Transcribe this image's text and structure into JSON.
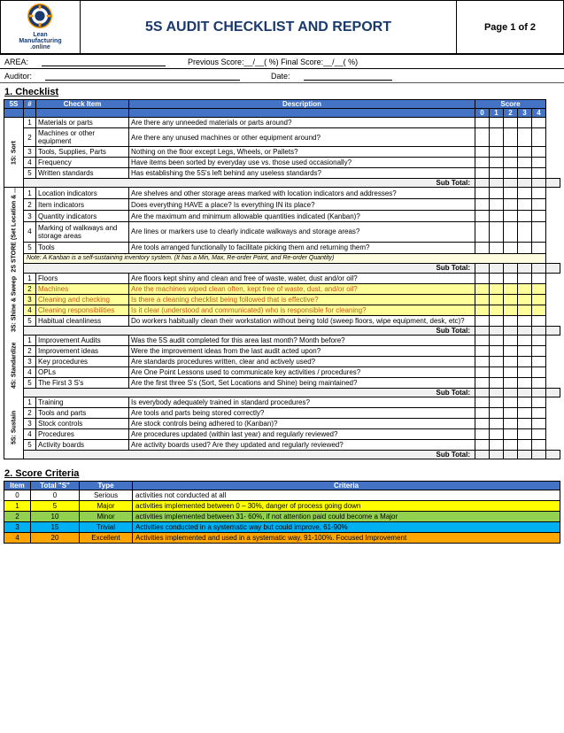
{
  "header": {
    "title": "5S AUDIT CHECKLIST AND REPORT",
    "page": "Page 1 of 2",
    "logo_line1": "Lean",
    "logo_line2": "Manufacturing",
    "logo_line3": ".online"
  },
  "form": {
    "area_label": "AREA:",
    "prev_score_label": "Previous Score:__/__( %) Final Score:__/__( %)",
    "auditor_label": "Auditor:",
    "date_label": "Date:"
  },
  "section1_title": "1. Checklist",
  "table_headers": {
    "five_s": "5S",
    "num": "#",
    "check_item": "Check Item",
    "description": "Description",
    "score": "Score",
    "score_nums": [
      "0",
      "1",
      "2",
      "3",
      "4"
    ]
  },
  "categories": [
    {
      "name": "1S: Sort",
      "items": [
        {
          "num": 1,
          "check": "Materials or parts",
          "desc": "Are there any unneeded materials or parts around?"
        },
        {
          "num": 2,
          "check": "Machines or other equipment",
          "desc": "Are there any unused machines or other equipment around?"
        },
        {
          "num": 3,
          "check": "Tools, Supplies, Parts",
          "desc": "Nothing on the floor except Legs, Wheels, or Pallets?"
        },
        {
          "num": 4,
          "check": "Frequency",
          "desc": "Have items been sorted by everyday use vs. those used occasionally?"
        },
        {
          "num": 5,
          "check": "Written standards",
          "desc": "Has establishing the 5S's left behind any useless standards?"
        }
      ],
      "subtotal": "Sub Total:"
    },
    {
      "name": "2S STORE (Set Location & ...",
      "items": [
        {
          "num": 1,
          "check": "Location indicators",
          "desc": "Are shelves and other storage areas marked with location indicators and addresses?"
        },
        {
          "num": 2,
          "check": "Item indicators",
          "desc": "Does everything HAVE a place?  Is everything IN its place?"
        },
        {
          "num": 3,
          "check": "Quantity indicators",
          "desc": "Are the maximum and minimum allowable quantities indicated (Kanban)?"
        },
        {
          "num": 4,
          "check": "Marking of walkways and storage areas",
          "desc": "Are lines or markers use to clearly indicate walkways and storage areas?"
        },
        {
          "num": 5,
          "check": "Tools",
          "desc": "Are tools arranged functionally to facilitate picking them and returning them?"
        }
      ],
      "note": "Note: A Kanban is a self-sustaining inventory system. (It has a Min, Max, Re-order Point, and Re-order Quantity)",
      "subtotal": "Sub Total:"
    },
    {
      "name": "3S: Shine & Sweep",
      "items": [
        {
          "num": 1,
          "check": "Floors",
          "desc": "Are floors kept shiny and clean and free of waste, water, dust and/or oil?"
        },
        {
          "num": 2,
          "check": "Machines",
          "desc": "Are the machines wiped clean often, kept free of waste, dust, and/or oil?",
          "highlight": true
        },
        {
          "num": 3,
          "check": "Cleaning and checking",
          "desc": "Is there a cleaning checklist being followed that is effective?",
          "highlight": true
        },
        {
          "num": 4,
          "check": "Cleaning responsibilities",
          "desc": "Is it clear (understood and communicated) who is responsible for cleaning?",
          "highlight": true
        },
        {
          "num": 5,
          "check": "Habitual cleanliness",
          "desc": "Do workers habitually clean their workstation without being told (sweep floors, wipe equipment, desk, etc)?"
        }
      ],
      "subtotal": "Sub Total:"
    },
    {
      "name": "4S: Standardize",
      "items": [
        {
          "num": 1,
          "check": "Improvement Audits",
          "desc": "Was the 5S audit completed for this area last month? Month before?"
        },
        {
          "num": 2,
          "check": "Improvement ideas",
          "desc": "Were the improvement ideas from the last audit acted upon?"
        },
        {
          "num": 3,
          "check": "Key procedures",
          "desc": "Are standards procedures written, clear and actively used?"
        },
        {
          "num": 4,
          "check": "OPLs",
          "desc": "Are One Point Lessons used to communicate key activities / procedures?"
        },
        {
          "num": 5,
          "check": "The First 3 S's",
          "desc": "Are the first three S's (Sort, Set Locations and Shine) being maintained?"
        }
      ],
      "subtotal": "Sub Total:"
    },
    {
      "name": "5S: Sustain",
      "items": [
        {
          "num": 1,
          "check": "Training",
          "desc": "Is everybody adequately trained in standard procedures?"
        },
        {
          "num": 2,
          "check": "Tools and parts",
          "desc": "Are tools and parts being stored correctly?"
        },
        {
          "num": 3,
          "check": "Stock controls",
          "desc": "Are stock controls being adhered to (Kanban)?"
        },
        {
          "num": 4,
          "check": "Procedures",
          "desc": "Are procedures updated (within last year) and regularly reviewed?"
        },
        {
          "num": 5,
          "check": "Activity boards",
          "desc": "Are activity boards used?  Are they updated and regularly reviewed?"
        }
      ],
      "subtotal": "Sub Total:"
    }
  ],
  "section2_title": "2. Score Criteria",
  "criteria_headers": [
    "Item",
    "Total \"S\"",
    "Type",
    "Criteria"
  ],
  "criteria_rows": [
    {
      "item": 0,
      "total": 0,
      "type": "Serious",
      "criteria": "activities not conducted at all",
      "color": "white"
    },
    {
      "item": 1,
      "total": 5,
      "type": "Major",
      "criteria": "activities implemented between 0 – 30%, danger of process going down",
      "color": "yellow"
    },
    {
      "item": 2,
      "total": 10,
      "type": "Minor",
      "criteria": "activities implemented between 31- 60%, if not attention paid could become a Major",
      "color": "green"
    },
    {
      "item": 3,
      "total": 15,
      "type": "Trivial",
      "criteria": "Activities conducted in a systematic way but could improve, 61-90%",
      "color": "blue"
    },
    {
      "item": 4,
      "total": 20,
      "type": "Excellent",
      "criteria": "Activities implemented and used in a systematic way, 91-100%. Focused Improvement",
      "color": "orange"
    }
  ]
}
